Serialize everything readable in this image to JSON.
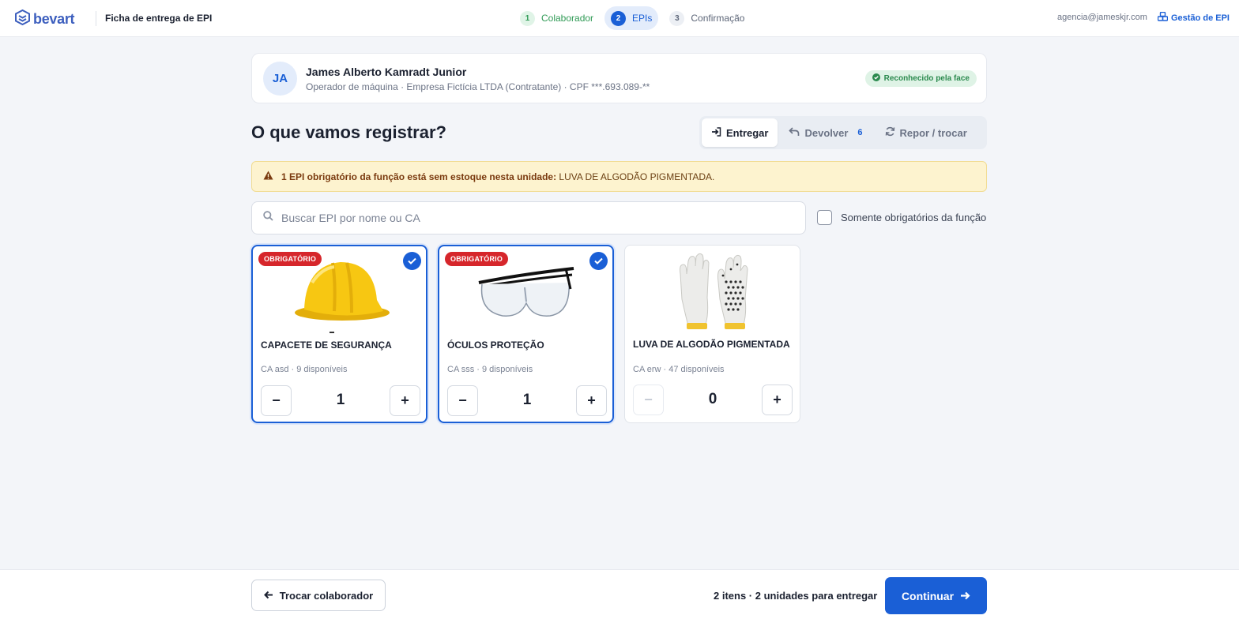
{
  "header": {
    "logo_text": "bevart",
    "app_title": "Ficha de entrega de EPI",
    "steps": [
      {
        "num": "1",
        "label": "Colaborador",
        "state": "done"
      },
      {
        "num": "2",
        "label": "EPIs",
        "state": "active"
      },
      {
        "num": "3",
        "label": "Confirmação",
        "state": "todo"
      }
    ],
    "user_email": "agencia@jameskjr.com",
    "gestao_link": "Gestão de EPI"
  },
  "worker": {
    "initials": "JA",
    "name": "James Alberto Kamradt Junior",
    "meta": "Operador de máquina · Empresa Fictícia LTDA (Contratante) · CPF ***.693.089-**",
    "face_badge": "Reconhecido pela face"
  },
  "main": {
    "title": "O que vamos registrar?",
    "modes": [
      {
        "label": "Entregar",
        "icon": "sign-in-icon",
        "active": true
      },
      {
        "label": "Devolver",
        "icon": "undo-icon",
        "count": "6",
        "active": false
      },
      {
        "label": "Repor / trocar",
        "icon": "refresh-icon",
        "active": false
      }
    ],
    "alert": {
      "bold": "1 EPI obrigatório da função está sem estoque nesta unidade:",
      "rest": "LUVA DE ALGODÃO PIGMENTADA."
    },
    "search_placeholder": "Buscar EPI por nome ou CA",
    "only_required_label": "Somente obrigatórios da função",
    "products": [
      {
        "name": "CAPACETE DE SEGURANÇA",
        "meta": "CA asd · 9 disponíveis",
        "qty": "1",
        "required": true,
        "selected": true,
        "badge": "OBRIGATÓRIO",
        "image": "helmet"
      },
      {
        "name": "ÓCULOS PROTEÇÃO",
        "meta": "CA sss · 9 disponíveis",
        "qty": "1",
        "required": true,
        "selected": true,
        "badge": "OBRIGATÓRIO",
        "image": "glasses"
      },
      {
        "name": "LUVA DE ALGODÃO PIGMENTADA",
        "meta": "CA erw · 47 disponíveis",
        "qty": "0",
        "required": false,
        "selected": false,
        "image": "gloves"
      }
    ],
    "minus": "−",
    "plus": "+"
  },
  "footer": {
    "back_label": "Trocar colaborador",
    "summary": "2 itens · 2 unidades para entregar",
    "continue_label": "Continuar"
  },
  "colors": {
    "primary": "#1a5fd6",
    "required_badge": "#d6262b",
    "alert_bg": "#fdf3cf",
    "success": "#2b8a4e"
  }
}
